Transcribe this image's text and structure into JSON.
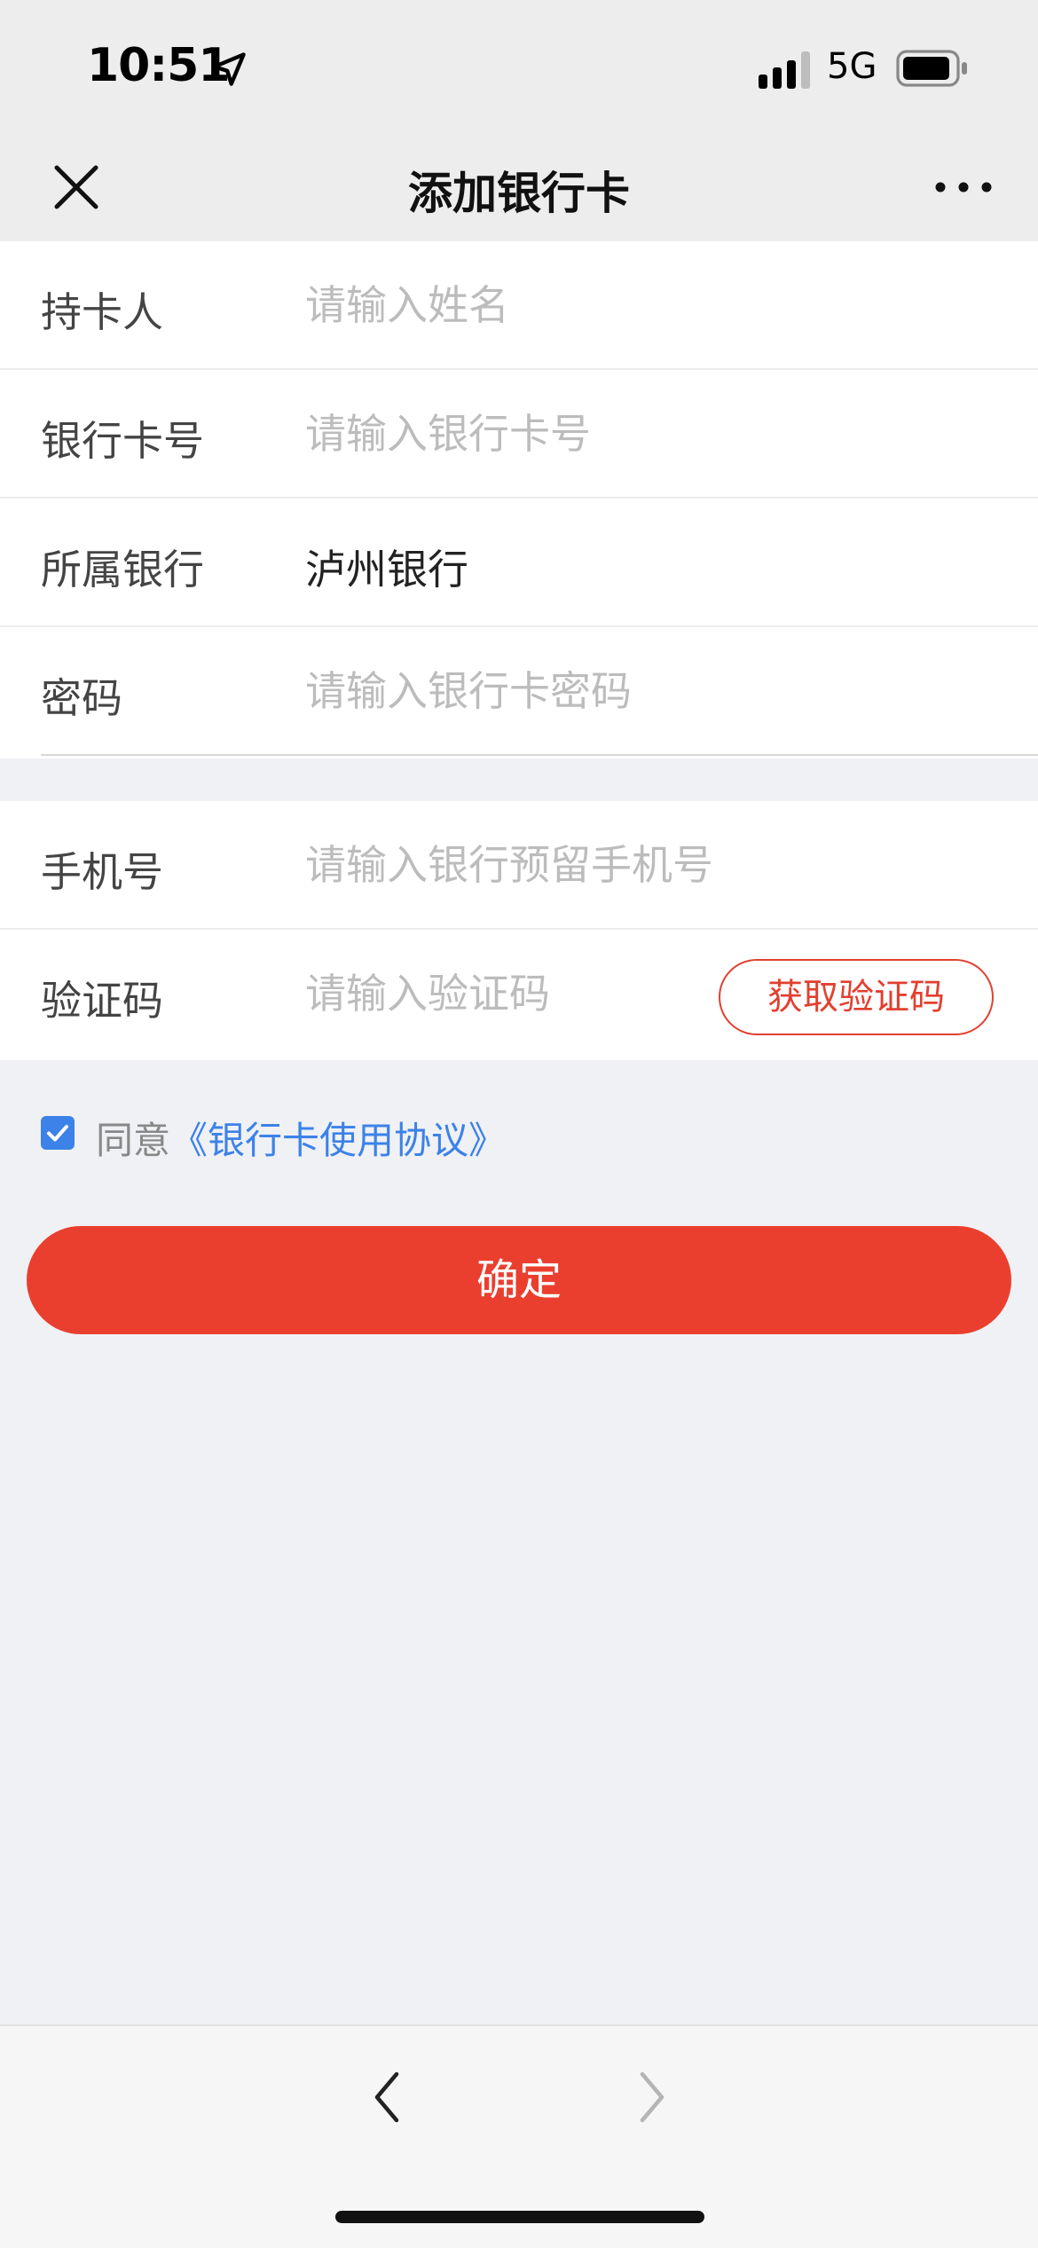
{
  "status_bar": {
    "time": "10:51",
    "network": "5G",
    "icons": [
      "location-arrow-icon",
      "signal-icon",
      "battery-icon"
    ]
  },
  "nav": {
    "title": "添加银行卡",
    "icons": [
      "close-icon",
      "more-icon"
    ]
  },
  "form": {
    "holder": {
      "label": "持卡人",
      "placeholder": "请输入姓名"
    },
    "card_number": {
      "label": "银行卡号",
      "placeholder": "请输入银行卡号"
    },
    "bank": {
      "label": "所属银行",
      "value": "泸州银行"
    },
    "password": {
      "label": "密码",
      "placeholder": "请输入银行卡密码"
    },
    "phone": {
      "label": "手机号",
      "placeholder": "请输入银行预留手机号"
    },
    "code": {
      "label": "验证码",
      "placeholder": "请输入验证码",
      "button": "获取验证码"
    }
  },
  "agreement": {
    "checked": true,
    "prefix": "同意",
    "link": "《银行卡使用协议》"
  },
  "confirm_label": "确定",
  "toolbar": {
    "icons": [
      "back-arrow-icon",
      "forward-arrow-icon"
    ]
  },
  "colors": {
    "accent": "#ea3f2f",
    "link": "#3c82e8",
    "placeholder": "#bcbcbc"
  }
}
